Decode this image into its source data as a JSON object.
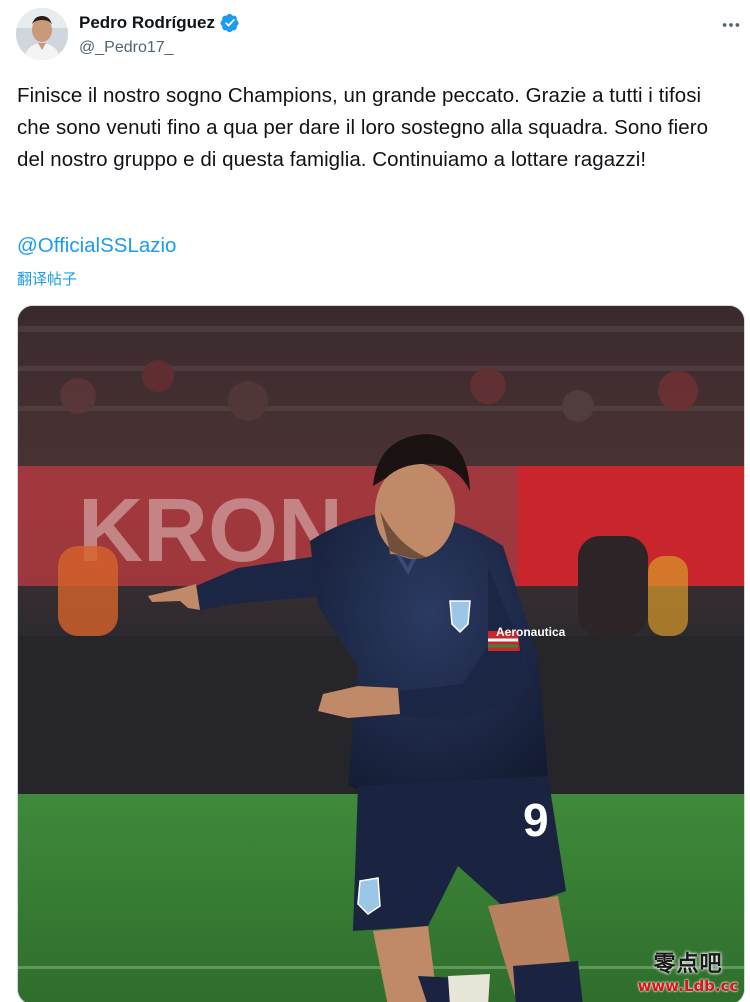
{
  "author": {
    "display_name": "Pedro Rodríguez",
    "handle": "@_Pedro17_",
    "verified": true,
    "verified_color": "#1d9bf0"
  },
  "tweet": {
    "text": "Finisce il nostro sogno Champions, un grande peccato. Grazie a tutti i tifosi che sono venuti fino a qua per dare il loro sostegno alla squadra. Sono fiero del nostro gruppo e di questa famiglia. Continuiamo a lottare ragazzi!",
    "mention": "@OfficialSSLazio",
    "translate_label": "翻译帖子"
  },
  "media": {
    "jersey_number": "9",
    "sponsor": "Aeronautica",
    "jersey_color": "#1e2a4a",
    "pitch_color": "#3f8a3a"
  },
  "watermark": {
    "site_name": "零点吧",
    "url": "www.Ldb.cc"
  },
  "colors": {
    "link": "#1d9bf0",
    "text": "#0f1419",
    "secondary": "#536471"
  },
  "icons": {
    "verified": "verified-badge-icon",
    "more": "more-options-icon"
  }
}
